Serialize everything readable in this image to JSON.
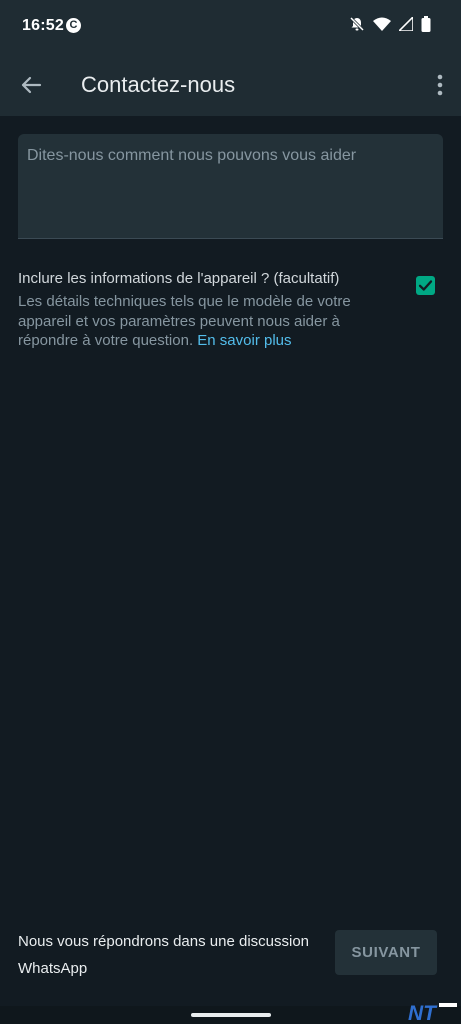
{
  "status_bar": {
    "time": "16:52",
    "app_badge": "C",
    "icons": [
      "bell-off-icon",
      "wifi-icon",
      "signal-icon",
      "battery-icon"
    ]
  },
  "app_bar": {
    "title": "Contactez-nous",
    "back_icon": "arrow-left-icon",
    "menu_icon": "more-vert-icon"
  },
  "message": {
    "placeholder": "Dites-nous comment nous pouvons vous aider",
    "value": ""
  },
  "device_info": {
    "heading": "Inclure les informations de l'appareil ? (facultatif)",
    "description": "Les détails techniques tels que le modèle de votre appareil et vos paramètres peuvent nous aider à répondre à votre question.",
    "learn_more": "En savoir plus",
    "checked": true
  },
  "footer": {
    "note": "Nous vous répondrons dans une discussion WhatsApp",
    "next_label": "SUIVANT"
  },
  "watermark": {
    "text": "NT"
  },
  "colors": {
    "background": "#121b22",
    "bar": "#1f2c33",
    "accent": "#00a884",
    "link": "#53bdeb"
  }
}
